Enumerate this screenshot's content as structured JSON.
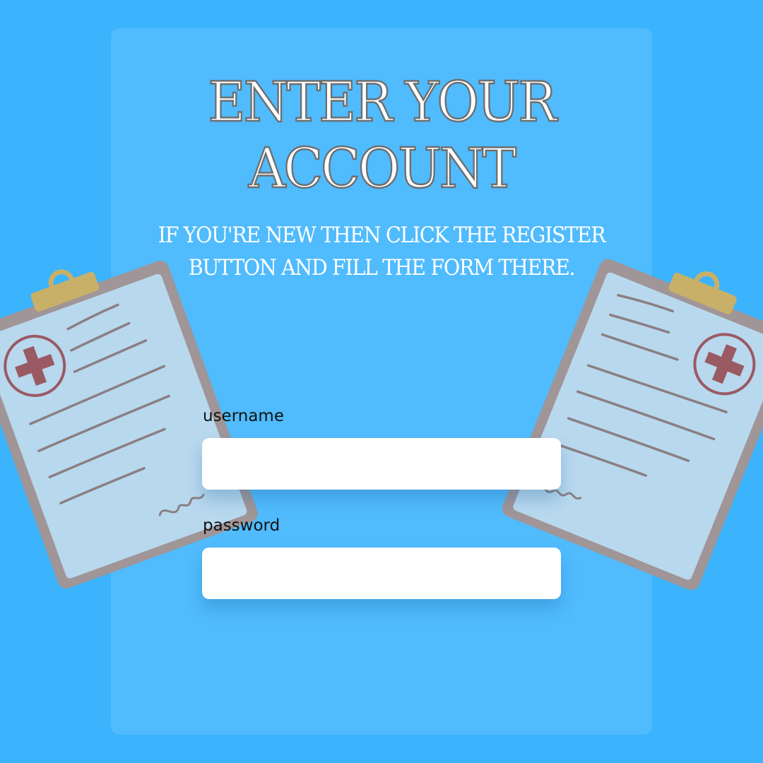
{
  "page": {
    "title": "ENTER YOUR ACCOUNT",
    "subtitle": "IF YOU'RE NEW THEN CLICK THE REGISTER BUTTON AND FILL THE FORM THERE."
  },
  "form": {
    "username_label": "username",
    "username_value": "",
    "password_label": "password",
    "password_value": ""
  },
  "colors": {
    "background": "#3bb3fd",
    "panel": "#4ebafc",
    "title_outline": "#6e6e6e",
    "clipboard_board": "#a09597",
    "clipboard_paper": "#b8d8ee",
    "clipboard_clip": "#c8b068",
    "medical_cross": "#9a5a63"
  },
  "icons": {
    "left_decoration": "medical-clipboard-icon",
    "right_decoration": "medical-clipboard-icon"
  }
}
